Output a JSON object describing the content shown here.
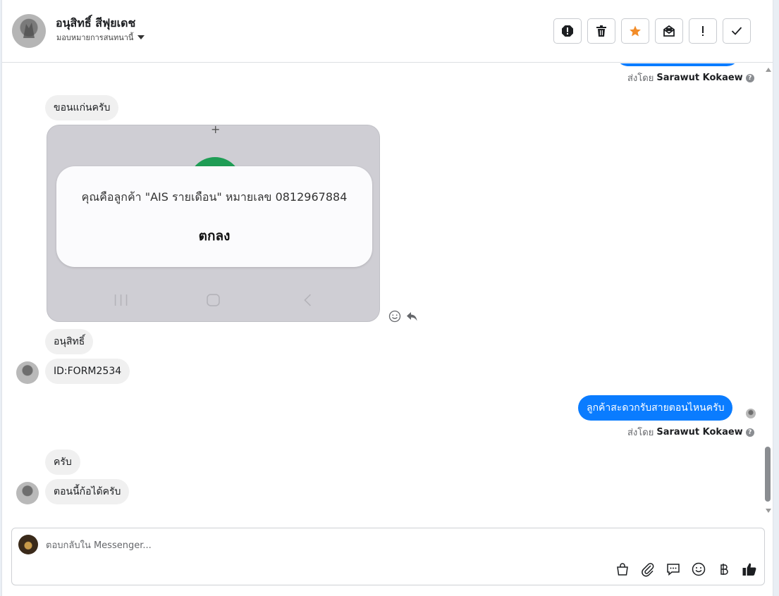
{
  "header": {
    "contact_name": "อนุสิทธิ์ สีฟุยเดช",
    "assign_label": "มอบหมายการสนทนานี้",
    "actions": [
      "alert-icon",
      "trash-icon",
      "star-icon",
      "mail-icon",
      "exclamation-icon",
      "check-icon"
    ]
  },
  "messages": {
    "sent_by_prefix": "ส่งโดย",
    "sender_name": "Sarawut Kokaew",
    "in_1": "ขอนแก่นครับ",
    "screenshot": {
      "plus": "+",
      "dialog_text": "คุณคือลูกค้า \"AIS รายเดือน\" หมายเลข 0812967884",
      "dialog_button": "ตกลง"
    },
    "in_2": "อนุสิทธิ์",
    "in_3": "ID:FORM2534",
    "out_1": "ลูกค้าสะดวกรับสายตอนไหนครับ",
    "in_4": "ครับ",
    "in_5": "ตอนนี้ก้อได้ครับ"
  },
  "composer": {
    "placeholder": "ตอบกลับใน Messenger...",
    "tools": [
      "bag-icon",
      "paperclip-icon",
      "comment-icon",
      "emoji-icon",
      "baht-icon",
      "thumbs-up-icon"
    ]
  },
  "colors": {
    "accent": "#0a7cff",
    "incoming": "#f0f0f0",
    "star": "#f28c28"
  }
}
